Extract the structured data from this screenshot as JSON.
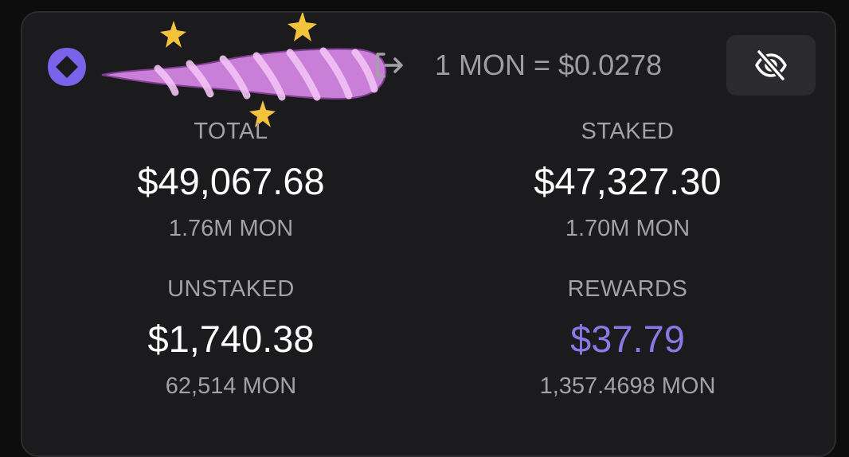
{
  "header": {
    "logo_icon": "monad-logo-icon",
    "logout_icon": "logout-icon",
    "price_text": "1 MON = $0.0278",
    "visibility_icon": "eye-off-icon"
  },
  "stats": {
    "total": {
      "label": "TOTAL",
      "value": "$49,067.68",
      "sub": "1.76M MON"
    },
    "staked": {
      "label": "STAKED",
      "value": "$47,327.30",
      "sub": "1.70M MON"
    },
    "unstaked": {
      "label": "UNSTAKED",
      "value": "$1,740.38",
      "sub": "62,514 MON"
    },
    "rewards": {
      "label": "REWARDS",
      "value": "$37.79",
      "sub": "1,357.4698 MON"
    }
  },
  "colors": {
    "card_bg": "#1b1a1c",
    "accent": "#8a78e4",
    "muted_text": "#a3a1a7",
    "scribble": "#c97fd8",
    "sparkle": "#f4c33c"
  }
}
